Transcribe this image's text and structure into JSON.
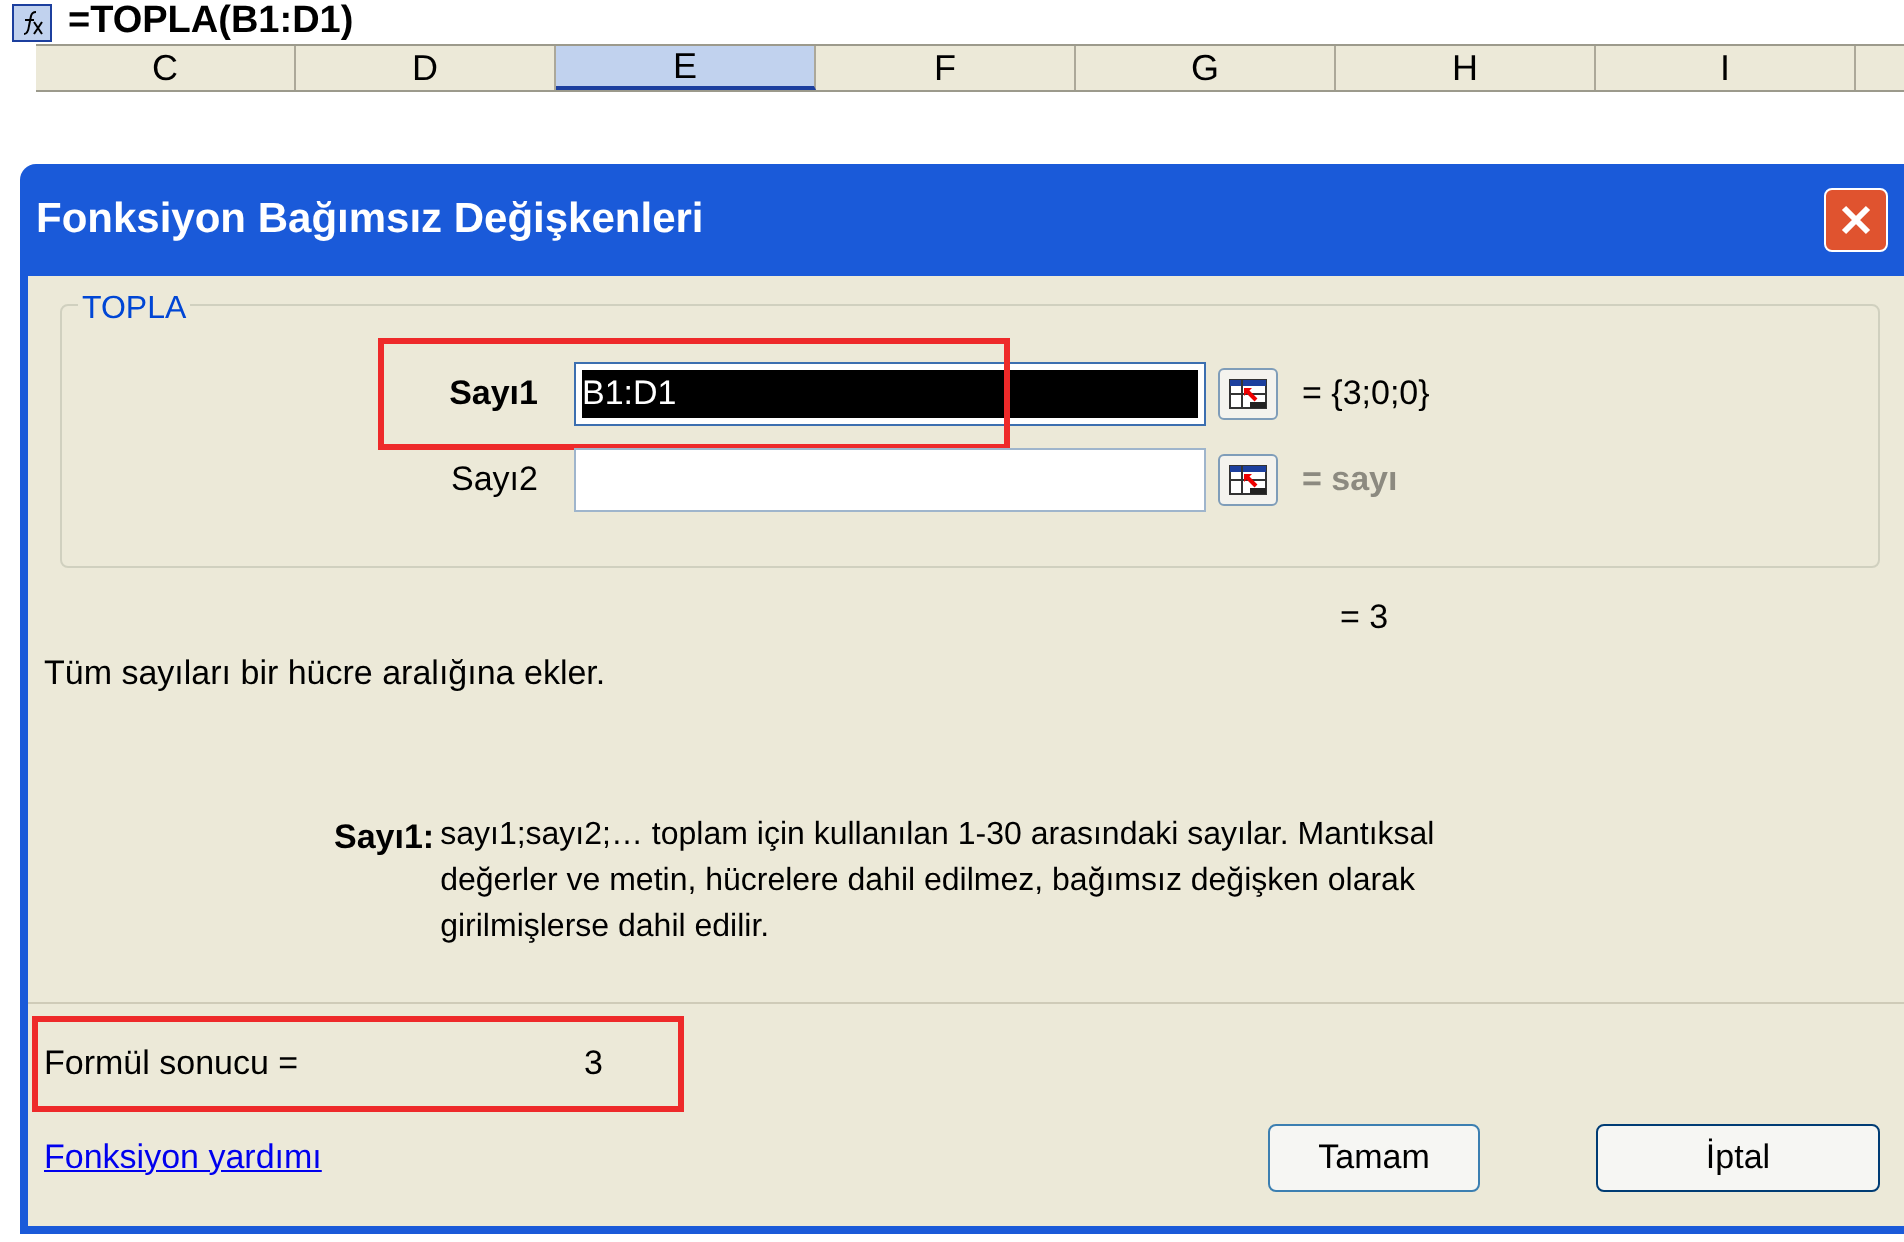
{
  "formula_bar": {
    "formula": "=TOPLA(B1:D1)"
  },
  "columns": [
    {
      "label": "C",
      "selected": false
    },
    {
      "label": "D",
      "selected": false
    },
    {
      "label": "E",
      "selected": true
    },
    {
      "label": "F",
      "selected": false
    },
    {
      "label": "G",
      "selected": false
    },
    {
      "label": "H",
      "selected": false
    },
    {
      "label": "I",
      "selected": false
    }
  ],
  "dialog": {
    "title": "Fonksiyon Bağımsız Değişkenleri",
    "group_title": "TOPLA",
    "arguments": [
      {
        "label": "Sayı1",
        "value": "B1:D1",
        "selected": true,
        "result": "= {3;0;0}",
        "highlighted": true
      },
      {
        "label": "Sayı2",
        "selected": false,
        "result": "= sayı",
        "highlighted": false
      }
    ],
    "function_result": "= 3",
    "description": "Tüm sayıları bir hücre aralığına ekler.",
    "help_label": "Sayı1:",
    "help_text": "sayı1;sayı2;… toplam için kullanılan 1-30 arasındaki sayılar. Mantıksal değerler ve metin, hücrelere dahil edilmez, bağımsız değişken olarak girilmişlerse dahil edilir.",
    "formula_result_label": "Formül sonucu =",
    "formula_result": "3",
    "formula_result_highlighted": true,
    "help_link": "Fonksiyon yardımı",
    "buttons": [
      "Tamam",
      "İptal"
    ]
  }
}
